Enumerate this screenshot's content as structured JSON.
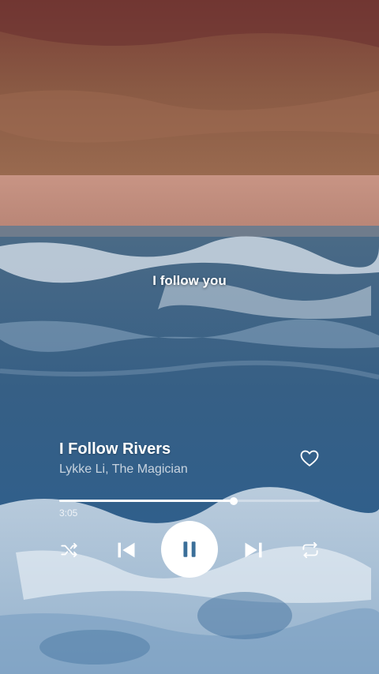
{
  "lyrics": {
    "current_line": "I follow you"
  },
  "track": {
    "title": "I Follow Rivers",
    "artist": "Lykke Li, The Magician",
    "liked": false
  },
  "playback": {
    "elapsed": "3:05",
    "progress": 0.67,
    "state": "playing"
  },
  "icons": {
    "shuffle": "shuffle-icon",
    "previous": "skip-previous-icon",
    "pause": "pause-icon",
    "next": "skip-next-icon",
    "repeat": "repeat-icon",
    "like": "heart-outline-icon"
  },
  "colors": {
    "accent": "#ffffff",
    "pause_glyph": "#3b6f99"
  }
}
